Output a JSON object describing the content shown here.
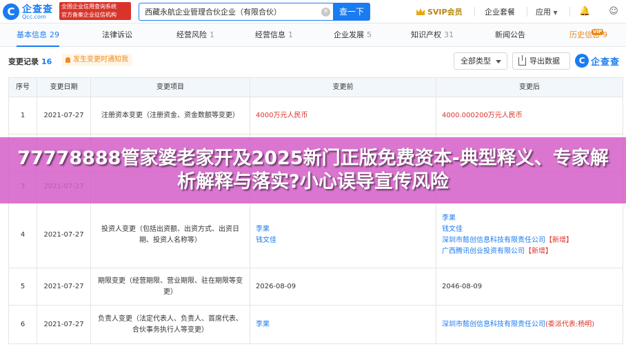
{
  "header": {
    "logo_name": "企查查",
    "logo_domain": "Qcc.com",
    "gov_badge_line1": "全国企业信用查询系统",
    "gov_badge_line2": "官方备案企业征信机构",
    "search_value": "西藏永航企业管理合伙企业（有限合伙）",
    "search_button": "查一下",
    "svip_label": "SVIP会员",
    "nav_package": "企业套餐",
    "nav_apps": "应用"
  },
  "tabs": [
    {
      "label": "基本信息",
      "count": "29"
    },
    {
      "label": "法律诉讼",
      "count": ""
    },
    {
      "label": "经营风险",
      "count": "1"
    },
    {
      "label": "经营信息",
      "count": "1"
    },
    {
      "label": "企业发展",
      "count": "5"
    },
    {
      "label": "知识产权",
      "count": "31"
    },
    {
      "label": "新闻公告",
      "count": ""
    },
    {
      "label": "历史信息",
      "count": "9"
    }
  ],
  "vip_tag": "VIP",
  "section": {
    "title": "变更记录",
    "count": "16",
    "notice": "发生变更时通知我",
    "type_select": "全部类型",
    "export_label": "导出数据",
    "watermark": "企查查"
  },
  "table": {
    "headers": [
      "序号",
      "变更日期",
      "变更项目",
      "变更前",
      "变更后"
    ],
    "rows": [
      {
        "seq": "1",
        "date": "2021-07-27",
        "item": "注册资本变更（注册资金、资金数额等变更）",
        "before": [
          "4000万元人民币"
        ],
        "after": [
          "4000.000200万元人民币"
        ]
      },
      {
        "seq": "2",
        "date": "2021-07-27",
        "item": "",
        "before": [],
        "after": []
      },
      {
        "seq": "3",
        "date": "2021-07-27",
        "item": "",
        "before": [],
        "after": []
      },
      {
        "seq": "4",
        "date": "2021-07-27",
        "item": "投资人变更（包括出资额、出资方式、出资日期、投资人名称等）",
        "before": [
          "李果",
          "钱文佳"
        ],
        "after": [
          "李果",
          "钱文佳",
          "深圳市懿创信息科技有限责任公司",
          "广西腾讯创业投资有限公司"
        ]
      },
      {
        "seq": "5",
        "date": "2021-07-27",
        "item": "期限变更（经营期限、营业期限、驻在期限等变更）",
        "before": [
          "2026-08-09"
        ],
        "after": [
          "2046-08-09"
        ]
      },
      {
        "seq": "6",
        "date": "2021-07-27",
        "item": "负责人变更（法定代表人、负责人、首席代表、合伙事务执行人等变更）",
        "before": [
          "李果"
        ],
        "after": [
          "深圳市懿创信息科技有限责任公司"
        ]
      }
    ],
    "tag_new": "【新增】",
    "tag_appoint": "(委派代表:杨明)"
  },
  "banner": {
    "text": "77778888管家婆老家开及2025新门正版免费资本-典型释义、专家解析解释与落实?小心误导宣传风险"
  },
  "colors": {
    "brand": "#1a7cf2",
    "red": "#d9342b",
    "orange": "#e8891b",
    "banner": "#d560c8"
  }
}
